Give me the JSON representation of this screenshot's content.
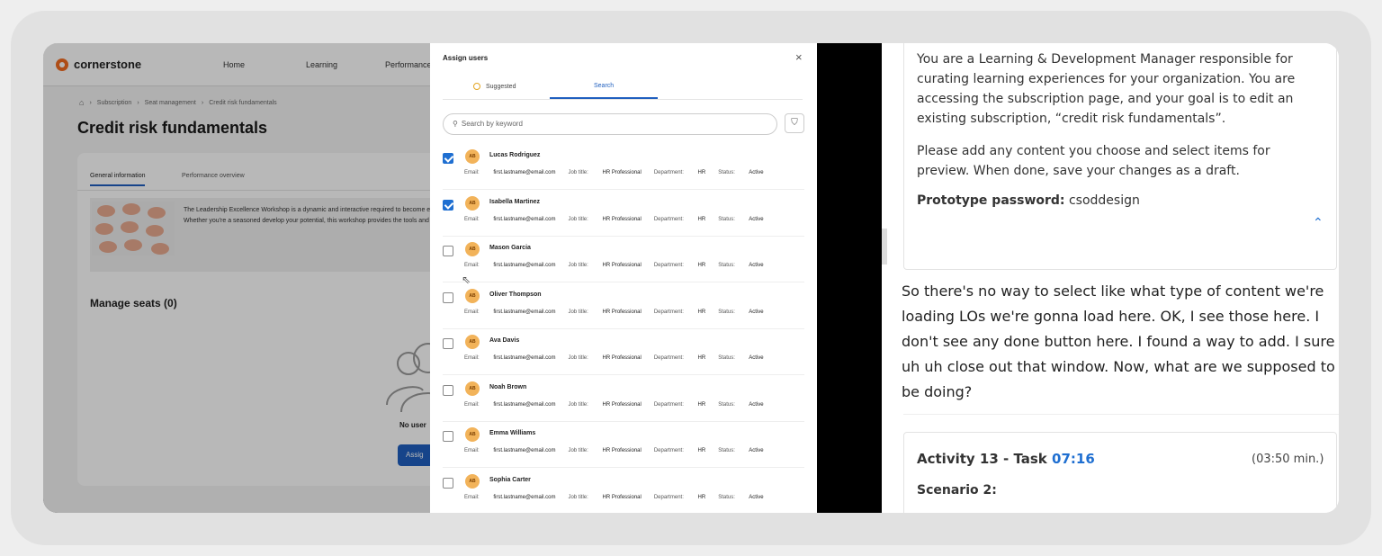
{
  "app": {
    "logo_text": "cornerstone",
    "nav": [
      "Home",
      "Learning",
      "Performance"
    ],
    "breadcrumb": [
      "Subscription",
      "Seat management",
      "Credit risk fundamentals"
    ],
    "page_title": "Credit risk fundamentals",
    "tabs": [
      "General information",
      "Performance overview"
    ],
    "description": "The Leadership Excellence Workshop is a dynamic and interactive required to become effective leaders. Whether you're a seasoned develop your potential, this workshop provides the tools and kno",
    "manage_seats": "Manage seats (0)",
    "no_users": "No user",
    "assign_button": "Assig"
  },
  "modal": {
    "title": "Assign users",
    "close": "×",
    "tab_suggested": "Suggested",
    "tab_search": "Search",
    "search_placeholder": "Search by keyword",
    "users": [
      {
        "name": "Lucas Rodriguez",
        "checked": true
      },
      {
        "name": "Isabella Martinez",
        "checked": true
      },
      {
        "name": "Mason Garcia",
        "checked": false
      },
      {
        "name": "Oliver Thompson",
        "checked": false
      },
      {
        "name": "Ava Davis",
        "checked": false
      },
      {
        "name": "Noah Brown",
        "checked": false
      },
      {
        "name": "Emma Williams",
        "checked": false
      },
      {
        "name": "Sophia Carter",
        "checked": false
      }
    ],
    "avatar_initials": "AB",
    "email_label": "Email:",
    "email_value": "first.lastname@email.com",
    "job_label": "Job title:",
    "job_value": "HR Professional",
    "dept_label": "Department:",
    "dept_value": "HR",
    "status_label": "Status:",
    "status_value": "Active"
  },
  "right": {
    "scenario_text": "You are a Learning & Development Manager responsible for curating learning experiences for your organization. You are accessing the subscription page, and your goal is to edit an existing subscription, “credit risk fundamentals”.",
    "scenario_text2": "Please add any content you choose and select items for preview. When done, save your changes as a draft.",
    "password_label": "Prototype password:",
    "password_value": "csoddesign",
    "transcript": "So there's no way to select like what type of content we're loading LOs we're gonna load here. OK, I see those here. I don't see any done button here. I found a way to add. I sure uh uh close out that window. Now, what are we supposed to be doing?",
    "activity_title": "Activity 13 - Task",
    "activity_time": "07:16",
    "activity_duration": "(03:50 min.)",
    "activity_scenario": "Scenario 2:"
  },
  "colors": {
    "accent": "#1f6fd1",
    "brand_orange": "#f26b21",
    "avatar": "#f2b35a"
  }
}
